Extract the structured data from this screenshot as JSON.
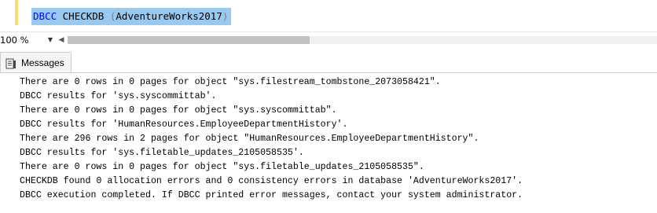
{
  "editor": {
    "keyword_dbcc": "DBCC",
    "keyword_checkdb": "CHECKDB",
    "open_paren": "(",
    "argument": "AdventureWorks2017",
    "close_paren": ")"
  },
  "statusbar": {
    "zoom_value": "100 %",
    "zoom_dropdown_icon": "chevron-down-icon",
    "scroll_left_icon": "chevron-left-icon"
  },
  "results": {
    "tabs": [
      {
        "label": "Messages",
        "icon": "messages-icon"
      }
    ],
    "messages": [
      "There are 0 rows in 0 pages for object \"sys.filestream_tombstone_2073058421\".",
      "DBCC results for 'sys.syscommittab'.",
      "There are 0 rows in 0 pages for object \"sys.syscommittab\".",
      "DBCC results for 'HumanResources.EmployeeDepartmentHistory'.",
      "There are 296 rows in 2 pages for object \"HumanResources.EmployeeDepartmentHistory\".",
      "DBCC results for 'sys.filetable_updates_2105058535'.",
      "There are 0 rows in 0 pages for object \"sys.filetable_updates_2105058535\".",
      "CHECKDB found 0 allocation errors and 0 consistency errors in database 'AdventureWorks2017'.",
      "DBCC execution completed. If DBCC printed error messages, contact your system administrator."
    ]
  },
  "colors": {
    "keyword": "#0000ff",
    "selection": "#99c9ef",
    "change_marker": "#f7dc6f"
  }
}
